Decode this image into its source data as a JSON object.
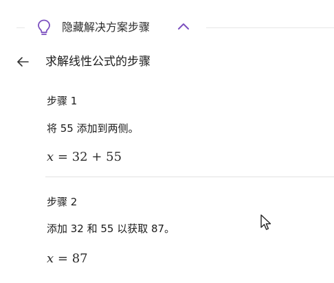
{
  "solution_toggle": {
    "label": "隐藏解决方案步骤",
    "icon": "lightbulb-icon",
    "chevron": "chevron-up-icon",
    "accent_color": "#7b4fbf"
  },
  "header": {
    "back_icon": "back-arrow-icon",
    "title": "求解线性公式的步骤"
  },
  "steps": [
    {
      "title": "步骤 1",
      "description": "将 55 添加到两侧。",
      "equation": {
        "variable": "x",
        "rhs": "= 32 + 55"
      }
    },
    {
      "title": "步骤 2",
      "description": "添加 32 和 55 以获取 87。",
      "equation": {
        "variable": "x",
        "rhs": "= 87"
      }
    }
  ]
}
